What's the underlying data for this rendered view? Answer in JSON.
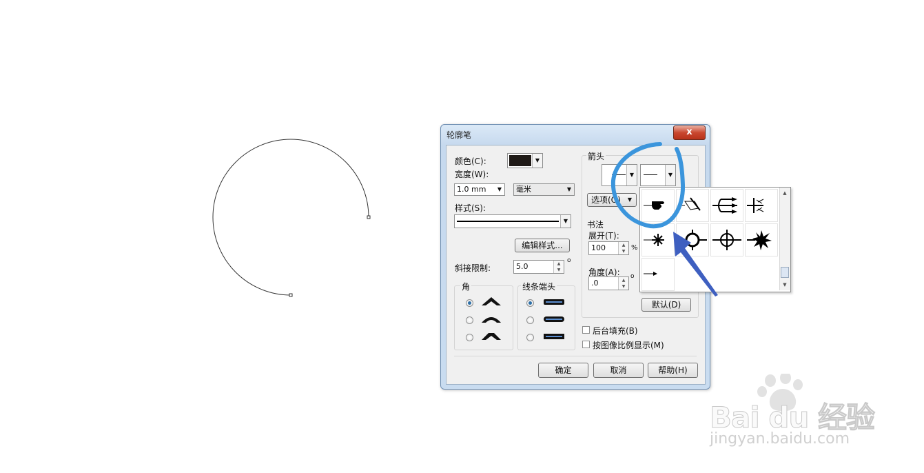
{
  "dialog": {
    "title": "轮廓笔",
    "close_label": "x",
    "color_label": "颜色(C):",
    "color_value": "#1f1a17",
    "width_label": "宽度(W):",
    "width_value": "1.0 mm",
    "unit_value": "毫米",
    "style_label": "样式(S):",
    "edit_style_button": "编辑样式...",
    "miter_label": "斜接限制:",
    "miter_value": "5.0",
    "miter_unit": "o",
    "corner_group": "角",
    "line_caps_group": "线条端头",
    "arrows_label": "箭头",
    "options_button": "选项(O)",
    "calligraphy_label": "书法",
    "stretch_label": "展开(T):",
    "stretch_value": "100",
    "stretch_unit": "%",
    "angle_label": "角度(A):",
    "angle_value": ".0",
    "angle_unit": "o",
    "default_button": "默认(D)",
    "behind_fill_label": "后台填充(B)",
    "scale_with_image_label": "按图像比例显示(M)",
    "ok_button": "确定",
    "cancel_button": "取消",
    "help_button": "帮助(H)"
  },
  "arrow_popup": {
    "items": [
      "pointing-hand-arrow",
      "pen-nib-arrow",
      "trident-arrow",
      "tree-branch-arrow",
      "burst-small-arrow",
      "circle-ring-arrow",
      "crosshair-arrow",
      "starburst-arrow",
      "small-arrowhead"
    ]
  },
  "watermark": {
    "brand": "Bai du 经验",
    "url": "jingyan.baidu.com"
  },
  "colors": {
    "annotation_blue": "#3b95dc",
    "arrow_blue": "#3e5fc0",
    "radio_selected": "#2b6ea6"
  }
}
